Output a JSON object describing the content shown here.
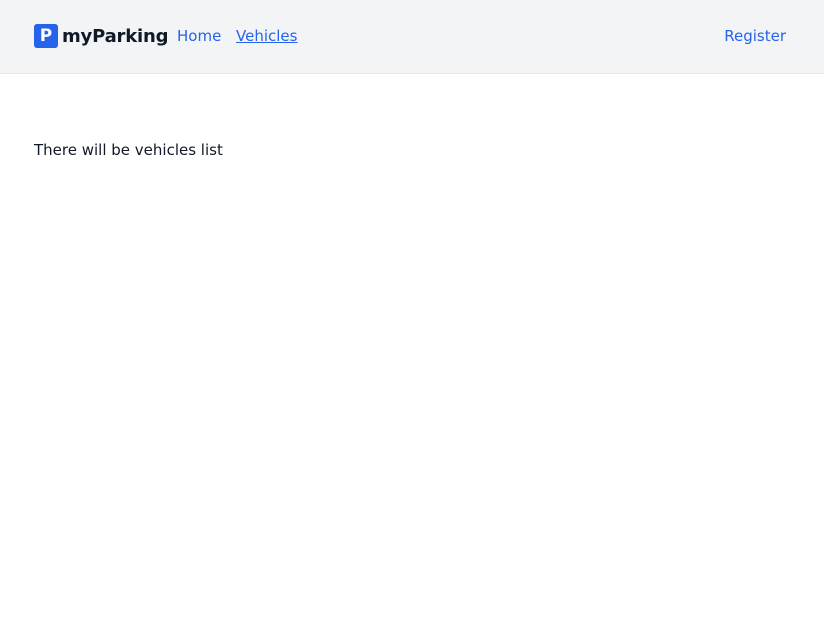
{
  "brand": {
    "logo_letter": "P",
    "name": "myParking"
  },
  "nav": {
    "home": "Home",
    "vehicles": "Vehicles",
    "register": "Register"
  },
  "main": {
    "message": "There will be vehicles list"
  },
  "colors": {
    "accent": "#2563eb",
    "header_bg": "#f3f4f6"
  }
}
